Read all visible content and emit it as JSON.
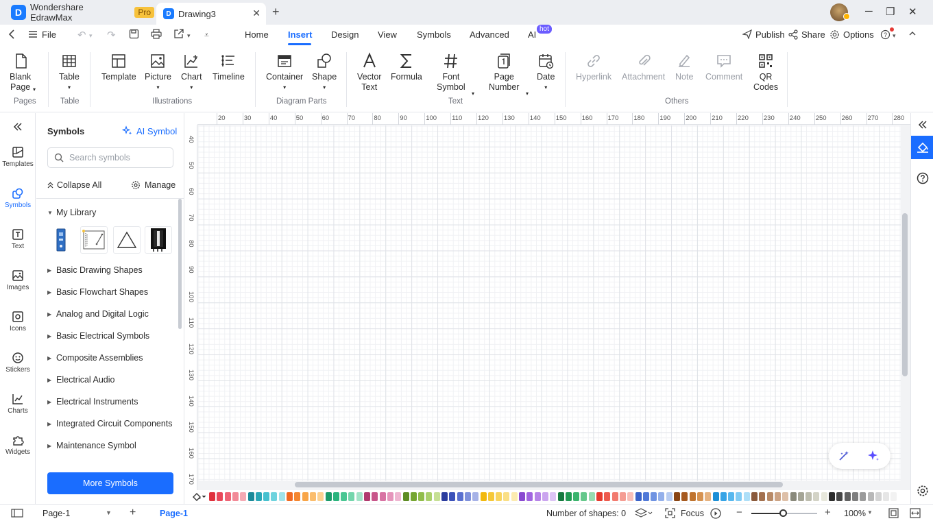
{
  "titlebar": {
    "app_name": "Wondershare EdrawMax",
    "plan_badge": "Pro",
    "document_tab": "Drawing3",
    "close_tab_icon": "close-icon",
    "new_tab_icon": "plus-icon"
  },
  "menubar": {
    "file_label": "File",
    "tabs": [
      {
        "label": "Home"
      },
      {
        "label": "Insert",
        "active": true
      },
      {
        "label": "Design"
      },
      {
        "label": "View"
      },
      {
        "label": "Symbols"
      },
      {
        "label": "Advanced"
      },
      {
        "label": "AI",
        "badge": "hot"
      }
    ],
    "publish_label": "Publish",
    "share_label": "Share",
    "options_label": "Options"
  },
  "ribbon": {
    "groups": [
      {
        "label": "Pages"
      },
      {
        "label": "Table"
      },
      {
        "label": "Illustrations"
      },
      {
        "label": "Diagram Parts"
      },
      {
        "label": "Text"
      },
      {
        "label": "Others"
      }
    ],
    "buttons": {
      "blank_page": "Blank\nPage",
      "table": "Table",
      "template": "Template",
      "picture": "Picture",
      "chart": "Chart",
      "timeline": "Timeline",
      "container": "Container",
      "shape": "Shape",
      "vector_text": "Vector\nText",
      "formula": "Formula",
      "font_symbol": "Font\nSymbol",
      "page_number": "Page\nNumber",
      "date": "Date",
      "hyperlink": "Hyperlink",
      "attachment": "Attachment",
      "note": "Note",
      "comment": "Comment",
      "qr_codes": "QR\nCodes"
    }
  },
  "left_rail": {
    "items": [
      {
        "label": "Templates",
        "icon": "templates-icon"
      },
      {
        "label": "Symbols",
        "icon": "symbols-icon",
        "active": true
      },
      {
        "label": "Text",
        "icon": "text-icon"
      },
      {
        "label": "Images",
        "icon": "images-icon"
      },
      {
        "label": "Icons",
        "icon": "icons-icon"
      },
      {
        "label": "Stickers",
        "icon": "stickers-icon"
      },
      {
        "label": "Charts",
        "icon": "charts-icon"
      },
      {
        "label": "Widgets",
        "icon": "widgets-icon"
      }
    ]
  },
  "symbols_panel": {
    "title": "Symbols",
    "ai_symbol_label": "AI Symbol",
    "search_placeholder": "Search symbols",
    "collapse_all_label": "Collapse All",
    "manage_label": "Manage",
    "my_library_label": "My Library",
    "library_items": [
      "Basic Drawing Shapes",
      "Basic Flowchart Shapes",
      "Analog and Digital Logic",
      "Basic Electrical Symbols",
      "Composite Assemblies",
      "Electrical Audio",
      "Electrical Instruments",
      "Integrated Circuit Components",
      "Maintenance Symbol"
    ],
    "more_symbols_label": "More Symbols"
  },
  "canvas": {
    "h_ruler": [
      "20",
      "30",
      "40",
      "50",
      "60",
      "70",
      "80",
      "90",
      "100",
      "110",
      "120",
      "130",
      "140",
      "150",
      "160",
      "170",
      "180",
      "190",
      "200",
      "210",
      "220",
      "230",
      "240",
      "250",
      "260",
      "270",
      "280"
    ],
    "v_ruler": [
      "40",
      "50",
      "60",
      "70",
      "80",
      "90",
      "100",
      "110",
      "120",
      "130",
      "140",
      "150",
      "160",
      "170"
    ]
  },
  "palette": {
    "colors": [
      "#e0313d",
      "#e8485a",
      "#ef6475",
      "#f28a97",
      "#f5aab4",
      "#1c8b9a",
      "#2aa7b6",
      "#46c1cf",
      "#6fd3de",
      "#a1e3ea",
      "#f06a22",
      "#f5862f",
      "#f8a548",
      "#fbbd6c",
      "#fcd192",
      "#1c9b6a",
      "#2ab47d",
      "#4ac693",
      "#74d6ac",
      "#a3e4c8",
      "#b13a6e",
      "#c8558a",
      "#d873a3",
      "#e595bb",
      "#efb6d1",
      "#5d8c23",
      "#76a632",
      "#91bd4b",
      "#abd06c",
      "#c6e094",
      "#2b3c9e",
      "#3c52ba",
      "#5a70cf",
      "#7f91dc",
      "#a6b2e7",
      "#f2b90f",
      "#f6c838",
      "#f8d45e",
      "#fadf85",
      "#fcebb0",
      "#8a4ad1",
      "#a165e0",
      "#b784e8",
      "#cba5ef",
      "#dcc4f4",
      "#167a3f",
      "#229a53",
      "#3bb46d",
      "#66c88c",
      "#98dbb0",
      "#e63b2e",
      "#ee5a4d",
      "#f27b6f",
      "#f59d93",
      "#f8bfb8",
      "#3a63c8",
      "#5079d8",
      "#6f93e2",
      "#94b0eb",
      "#b9cdf2",
      "#8a4514",
      "#a65a1f",
      "#c0742f",
      "#d69250",
      "#e6b27f",
      "#1c8fd6",
      "#36a4e6",
      "#58b8ee",
      "#82ccf4",
      "#addff8",
      "#8b5a3c",
      "#a3714f",
      "#b88a67",
      "#cca384",
      "#dec0a8",
      "#8a8a7c",
      "#a5a596",
      "#bdbdae",
      "#d3d3c6",
      "#e8e8dc",
      "#2d2d2d",
      "#474747",
      "#626262",
      "#7e7e7e",
      "#9b9b9b",
      "#b8b8b8",
      "#d4d4d4",
      "#e6e6e6",
      "#f2f2f2"
    ]
  },
  "statusbar": {
    "page_dropdown": "Page-1",
    "page_tab": "Page-1",
    "shape_count": "Number of shapes: 0",
    "focus_label": "Focus",
    "zoom": "100%",
    "zoom_level": 0.5
  }
}
